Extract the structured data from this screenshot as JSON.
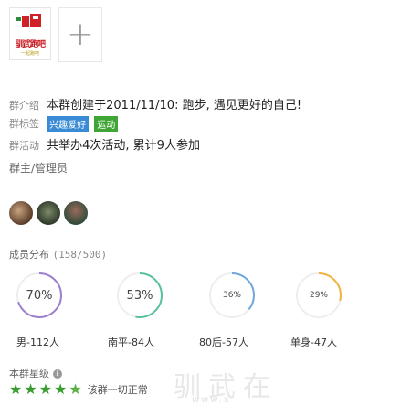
{
  "logo": {
    "text": "驯武跑吧",
    "sub": "一起跑吧"
  },
  "add_button": {
    "symbol": "+"
  },
  "intro": {
    "label": "群介绍",
    "value": "本群创建于2011/11/10: 跑步, 遇见更好的自己!"
  },
  "tags": {
    "label": "群标签",
    "items": [
      "兴趣爱好",
      "运动"
    ]
  },
  "activity": {
    "label": "群活动",
    "value": "共举办4次活动, 累计9人参加"
  },
  "admins": {
    "label": "群主/管理员"
  },
  "distribution": {
    "label": "成员分布",
    "count": "(158/500)",
    "rings": [
      {
        "pct": "70%",
        "value": 0.7,
        "color": "#9b7fcf"
      },
      {
        "pct": "53%",
        "value": 0.53,
        "color": "#57c29a"
      },
      {
        "pct": "36%",
        "value": 0.36,
        "color": "#6fa6e0"
      },
      {
        "pct": "29%",
        "value": 0.29,
        "color": "#f0b43c"
      }
    ],
    "stats": [
      "男-112人",
      "南平-84人",
      "80后-57人",
      "单身-47人"
    ]
  },
  "level": {
    "label": "本群星级",
    "info_icon": "i",
    "stars": 4.5,
    "desc": "该群一切正常"
  },
  "watermark": {
    "text": "驯武在",
    "url": "www.x"
  }
}
